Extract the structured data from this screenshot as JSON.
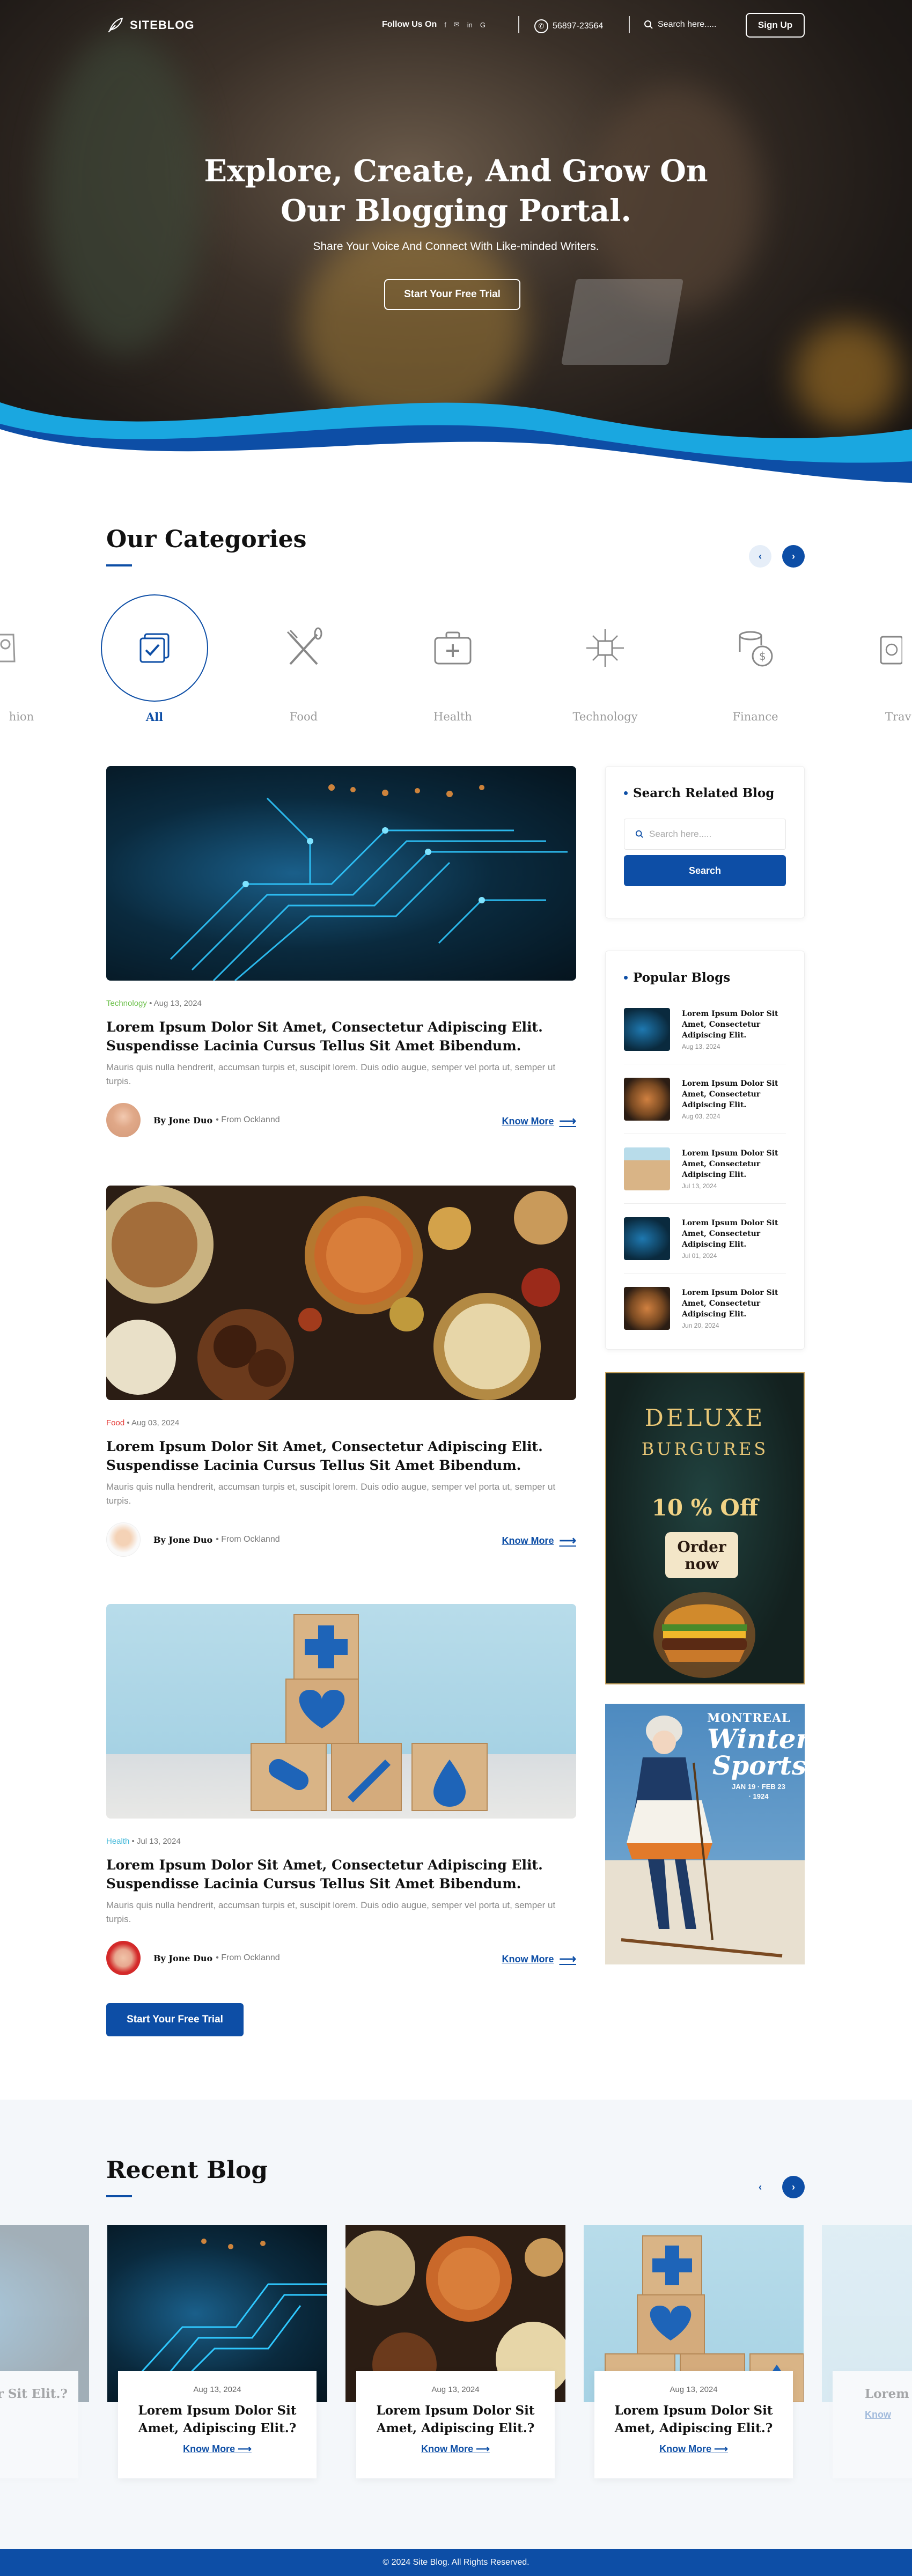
{
  "nav": {
    "logo": "SITEBLOG",
    "follow_label": "Follow Us On",
    "social": [
      "f",
      "✉",
      "in",
      "G"
    ],
    "phone": "56897-23564",
    "search_placeholder": "Search here.....",
    "signup": "Sign Up"
  },
  "hero": {
    "title_line1": "Explore, Create, And Grow On",
    "title_line2": "Our Blogging Portal.",
    "subtitle": "Share Your Voice And Connect With Like-minded Writers.",
    "cta": "Start Your Free Trial"
  },
  "categories": {
    "title": "Our Categories",
    "items": [
      "hion",
      "All",
      "Food",
      "Health",
      "Technology",
      "Finance",
      "Trav"
    ],
    "active": "All"
  },
  "posts": [
    {
      "category": "Technology",
      "category_color": "#6cc04a",
      "date": "Aug 13, 2024",
      "title": "Lorem Ipsum Dolor Sit Amet, Consectetur Adipiscing Elit. Suspendisse Lacinia Cursus Tellus Sit Amet Bibendum.",
      "desc": "Mauris quis nulla hendrerit, accumsan turpis et, suscipit lorem. Duis odio augue, semper vel porta ut, semper ut turpis.",
      "author": "By Jone Duo",
      "from": "From Ocklannd",
      "more": "Know More"
    },
    {
      "category": "Food",
      "category_color": "#e53935",
      "date": "Aug 03, 2024",
      "title": "Lorem Ipsum Dolor Sit Amet, Consectetur Adipiscing Elit. Suspendisse Lacinia Cursus Tellus Sit Amet Bibendum.",
      "desc": "Mauris quis nulla hendrerit, accumsan turpis et, suscipit lorem. Duis odio augue, semper vel porta ut, semper ut turpis.",
      "author": "By Jone Duo",
      "from": "From Ocklannd",
      "more": "Know More"
    },
    {
      "category": "Health",
      "category_color": "#42b8d9",
      "date": "Jul 13, 2024",
      "title": "Lorem Ipsum Dolor Sit Amet, Consectetur Adipiscing Elit. Suspendisse Lacinia Cursus Tellus Sit Amet Bibendum.",
      "desc": "Mauris quis nulla hendrerit, accumsan turpis et, suscipit lorem. Duis odio augue, semper vel porta ut, semper ut turpis.",
      "author": "By Jone Duo",
      "from": "From Ocklannd",
      "more": "Know More"
    }
  ],
  "sidebar": {
    "search_title": "Search Related Blog",
    "search_placeholder": "Search here.....",
    "search_button": "Search",
    "popular_title": "Popular Blogs",
    "popular": [
      {
        "title": "Lorem Ipsum Dolor Sit Amet, Consectetur Adipiscing Elit.",
        "date": "Aug 13, 2024"
      },
      {
        "title": "Lorem Ipsum Dolor Sit Amet, Consectetur Adipiscing Elit.",
        "date": "Aug 03, 2024"
      },
      {
        "title": "Lorem Ipsum Dolor Sit Amet, Consectetur Adipiscing Elit.",
        "date": "Jul 13, 2024"
      },
      {
        "title": "Lorem Ipsum Dolor Sit Amet, Consectetur Adipiscing Elit.",
        "date": "Jul 01, 2024"
      },
      {
        "title": "Lorem Ipsum Dolor Sit Amet, Consectetur Adipiscing Elit.",
        "date": "Jun 20, 2024"
      }
    ]
  },
  "ads": {
    "burger_line1": "DELUXE",
    "burger_line2": "BURGURES",
    "burger_offer": "10 % Off",
    "burger_cta_1": "Order",
    "burger_cta_2": "now",
    "poster_city": "MONTREAL",
    "poster_title_1": "Winter",
    "poster_title_2": "Sports",
    "poster_dates": "JAN 19 · FEB 23 · 1924"
  },
  "trial_button": "Start Your Free Trial",
  "recent": {
    "title": "Recent Blog",
    "cards": [
      {
        "date": "",
        "title": "Dolor Sit Elit.?",
        "more": ""
      },
      {
        "date": "Aug 13, 2024",
        "title": "Lorem Ipsum Dolor Sit Amet, Adipiscing Elit.?",
        "more": "Know More"
      },
      {
        "date": "Aug 13, 2024",
        "title": "Lorem Ipsum Dolor Sit Amet, Adipiscing Elit.?",
        "more": "Know More"
      },
      {
        "date": "Aug 13, 2024",
        "title": "Lorem Ipsum Dolor Sit Amet, Adipiscing Elit.?",
        "more": "Know More"
      },
      {
        "date": "",
        "title": "Lorem I Amet, A",
        "more": "Know"
      }
    ]
  },
  "footer": "© 2024 Site Blog. All Rights Reserved.",
  "colors": {
    "primary": "#0d4ea6",
    "accent": "#1aa7e0"
  }
}
